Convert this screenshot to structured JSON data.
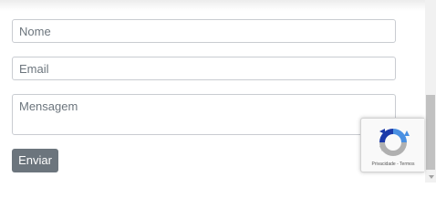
{
  "form": {
    "name_placeholder": "Nome",
    "email_placeholder": "Email",
    "message_placeholder": "Mensagem",
    "submit_label": "Enviar"
  },
  "recaptcha": {
    "privacy_label": "Privacidade",
    "separator": " - ",
    "terms_label": "Termos",
    "icon": "recaptcha-logo-icon"
  },
  "colors": {
    "button_bg": "#6c757d",
    "button_text": "#ffffff",
    "field_border": "#c9ccd1",
    "recaptcha_blue": "#4a90e2",
    "recaptcha_dark_blue": "#1c3aa9",
    "recaptcha_gray": "#b0b0b0"
  }
}
